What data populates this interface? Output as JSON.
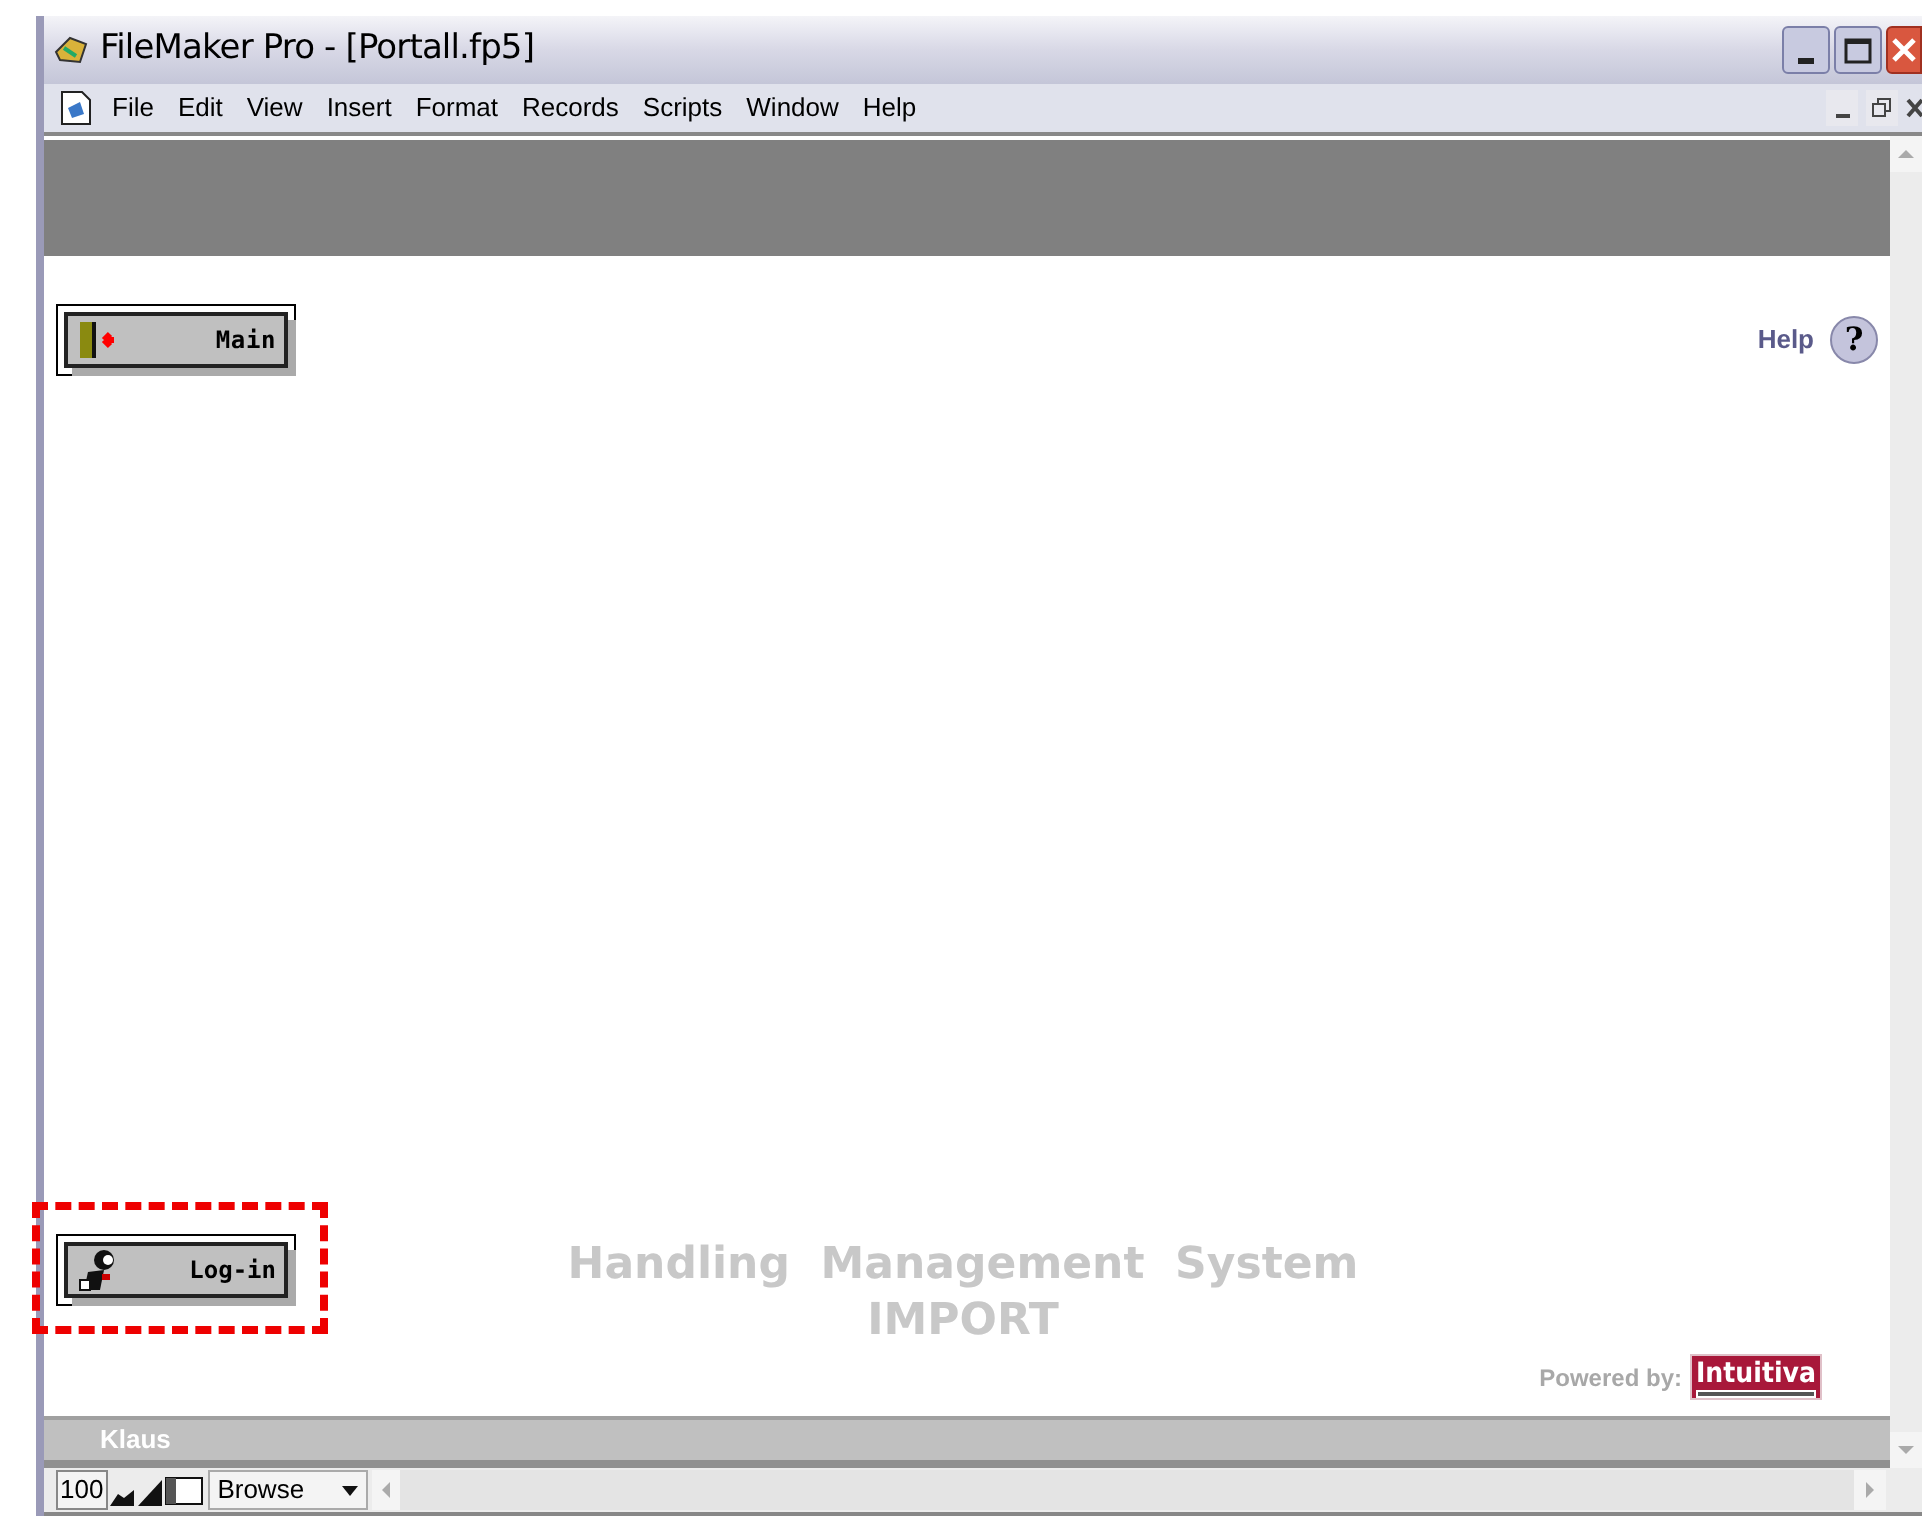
{
  "window": {
    "title": "FileMaker Pro - [Portall.fp5]"
  },
  "menu": [
    {
      "label": "File"
    },
    {
      "label": "Edit"
    },
    {
      "label": "View"
    },
    {
      "label": "Insert"
    },
    {
      "label": "Format"
    },
    {
      "label": "Records"
    },
    {
      "label": "Scripts"
    },
    {
      "label": "Window"
    },
    {
      "label": "Help"
    }
  ],
  "layout": {
    "help_label": "Help",
    "help_glyph": "?",
    "main_button": "Main",
    "login_button": "Log-in",
    "login_highlighted": true,
    "title_lines": [
      "Handling  Management  System",
      "IMPORT"
    ],
    "powered_by": "Powered by:",
    "brand": "Intuitiva"
  },
  "status_bar": {
    "user": "Klaus"
  },
  "toolbar": {
    "zoom": "100",
    "mode": "Browse"
  }
}
